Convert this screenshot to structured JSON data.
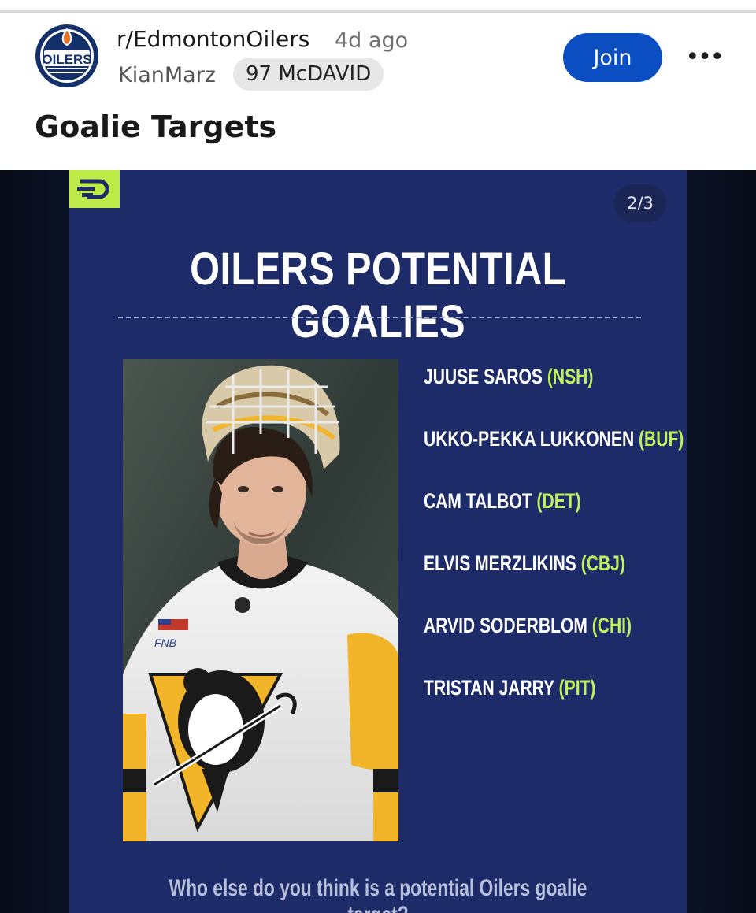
{
  "post": {
    "subreddit": "r/EdmontonOilers",
    "time_ago": "4d ago",
    "author": "KianMarz",
    "flair": "97 McDAVID",
    "join_label": "Join",
    "more_label": "•••",
    "title": "Goalie Targets",
    "avatar_icon": "oilers-logo-icon"
  },
  "image": {
    "page_indicator": "2/3",
    "headline": "OILERS POTENTIAL GOALIES",
    "goalies": [
      {
        "name": "JUUSE SAROS",
        "team": "(NSH)"
      },
      {
        "name": "UKKO-PEKKA LUKKONEN",
        "team": "(BUF)"
      },
      {
        "name": "CAM TALBOT",
        "team": "(DET)"
      },
      {
        "name": "ELVIS MERZLIKINS",
        "team": "(CBJ)"
      },
      {
        "name": "ARVID SODERBLOM",
        "team": "(CHI)"
      },
      {
        "name": "TRISTAN JARRY",
        "team": "(PIT)"
      }
    ],
    "question": "Who else do you think is a potential Oilers goalie target?",
    "photo_jersey_text": "FNB"
  },
  "colors": {
    "join_button": "#0a4ec2",
    "card_background": "#1d2b68",
    "team_accent": "#c3f05a",
    "brand_tag": "#bfeb49"
  }
}
